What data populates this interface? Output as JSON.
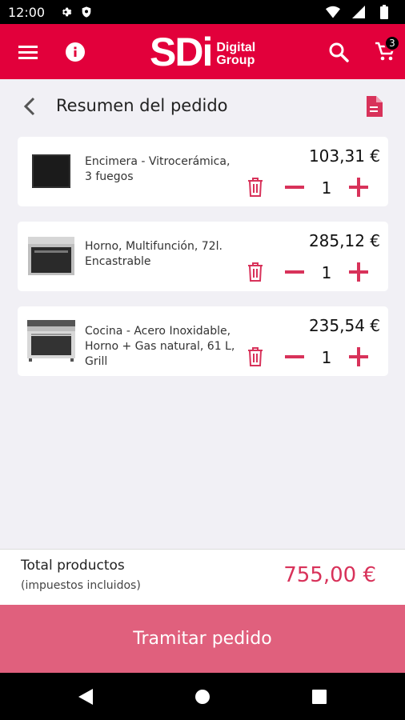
{
  "status_bar": {
    "time": "12:00"
  },
  "app_bar": {
    "logo_main": "SDi",
    "logo_line1": "Digital",
    "logo_line2": "Group",
    "cart_count": "3",
    "brand_color": "#e2003b"
  },
  "header": {
    "title": "Resumen del pedido"
  },
  "items": [
    {
      "name": "Encimera - Vitrocerámica, 3 fuegos",
      "price": "103,31 €",
      "qty": "1",
      "image": "cooktop"
    },
    {
      "name": "Horno, Multifunción, 72l. Encastrable",
      "price": "285,12 €",
      "qty": "1",
      "image": "oven"
    },
    {
      "name": "Cocina - Acero Inoxidable, Horno + Gas natural, 61 L, Grill",
      "price": "235,54 €",
      "qty": "1",
      "image": "range-cooker"
    }
  ],
  "summary": {
    "total_label": "Total productos",
    "total_sub": "(impuestos incluidos)",
    "total_amount": "755,00 €"
  },
  "checkout": {
    "label": "Tramitar pedido",
    "color": "#e0607d"
  },
  "accent_color": "#d8325a"
}
